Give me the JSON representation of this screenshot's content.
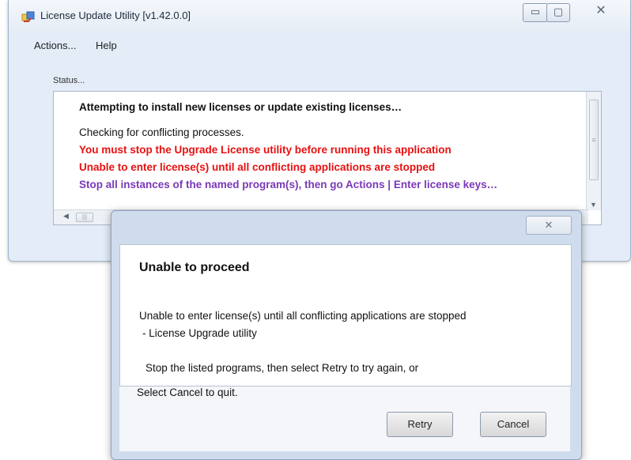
{
  "window": {
    "title": "License Update Utility [v1.42.0.0]",
    "minimize_glyph": "▭",
    "maximize_glyph": "▢",
    "close_glyph": "✕"
  },
  "menu": {
    "items": [
      {
        "label": "Actions..."
      },
      {
        "label": "Help"
      }
    ]
  },
  "status": {
    "group_label": "Status...",
    "heading": "Attempting to install new licenses or update existing licenses…",
    "info": "Checking for conflicting processes.",
    "errors": [
      "You must stop the Upgrade License utility before running this application",
      "Unable to enter license(s) until all conflicting applications are stopped"
    ],
    "hint": "Stop all instances of the named program(s), then go Actions | Enter license keys…"
  },
  "dialog": {
    "close_glyph": "✕",
    "heading": "Unable to proceed",
    "message": "Unable to enter license(s) until all conflicting applications are stopped",
    "source": "- License Upgrade utility",
    "instruction_1": "Stop the listed programs, then select Retry to try again, or",
    "instruction_2": "Select Cancel to quit.",
    "retry_label": "Retry",
    "cancel_label": "Cancel"
  },
  "colors": {
    "error": "#e81010",
    "hint": "#7a38b8"
  },
  "icons": {
    "app": "license-app-icon",
    "close": "close-icon",
    "minimize": "minimize-icon",
    "maximize": "maximize-icon",
    "scroll_left": "arrow-left-icon",
    "scroll_down": "arrow-down-icon"
  }
}
